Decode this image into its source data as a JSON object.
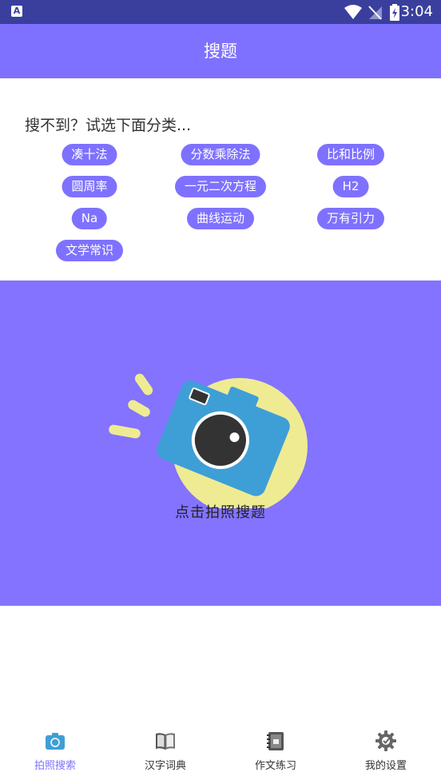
{
  "status_bar": {
    "app_badge": "A",
    "time": "3:04"
  },
  "header": {
    "title": "搜题"
  },
  "categories": {
    "hint": "搜不到？试选下面分类...",
    "tags": [
      "凑十法",
      "分数乘除法",
      "比和比例",
      "圆周率",
      "一元二次方程",
      "H2",
      "Na",
      "曲线运动",
      "万有引力",
      "文学常识"
    ]
  },
  "camera": {
    "label": "点击拍照搜题"
  },
  "bottom_nav": {
    "items": [
      {
        "label": "拍照搜索",
        "icon": "camera-icon",
        "active": true
      },
      {
        "label": "汉字词典",
        "icon": "book-icon",
        "active": false
      },
      {
        "label": "作文练习",
        "icon": "notebook-icon",
        "active": false
      },
      {
        "label": "我的设置",
        "icon": "gear-icon",
        "active": false
      }
    ]
  },
  "colors": {
    "accent": "#7f71ff",
    "status_bar": "#3a3f9e",
    "camera_blue": "#3e9fd6",
    "sun_yellow": "#efeb93"
  }
}
